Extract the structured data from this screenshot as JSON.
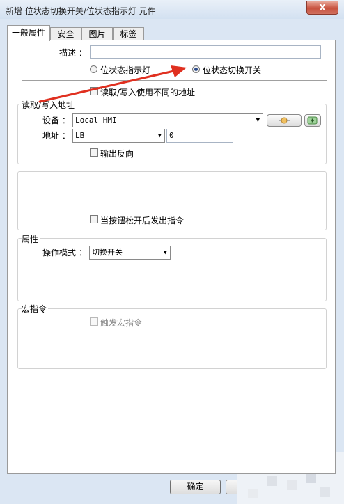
{
  "window": {
    "title": "新增 位状态切换开关/位状态指示灯 元件",
    "close_glyph": "X"
  },
  "tabs": [
    {
      "label": "一般属性",
      "active": true
    },
    {
      "label": "安全",
      "active": false
    },
    {
      "label": "图片",
      "active": false
    },
    {
      "label": "标签",
      "active": false
    }
  ],
  "description": {
    "label": "描述 ：",
    "value": ""
  },
  "object_type": {
    "options": [
      {
        "label": "位状态指示灯",
        "selected": false
      },
      {
        "label": "位状态切换开关",
        "selected": true
      }
    ]
  },
  "use_different_address": {
    "label": "读取/写入使用不同的地址",
    "checked": false
  },
  "rw_address": {
    "title": "读取/写入地址",
    "device_label": "设备 ：",
    "device_value": "Local HMI",
    "address_label": "地址 ：",
    "address_type": "LB",
    "address_value": "0",
    "invert_output": {
      "label": "输出反向",
      "checked": false
    }
  },
  "release_command": {
    "label": "当按钮松开后发出指令",
    "checked": false
  },
  "attributes": {
    "title": "属性",
    "mode_label": "操作模式 ：",
    "mode_value": "切换开关"
  },
  "macro": {
    "title": "宏指令",
    "trigger_label": "触发宏指令",
    "checked": false,
    "enabled": false
  },
  "footer": {
    "ok_label": "确定"
  },
  "colors": {
    "annotation_arrow": "#e03020",
    "window_bg": "#dbe6f3",
    "close_button": "#c7513e"
  },
  "icons": [
    "close-icon",
    "chevron-down-icon",
    "settings-icon",
    "device-setting-icon",
    "radio-icon",
    "checkbox-icon"
  ]
}
